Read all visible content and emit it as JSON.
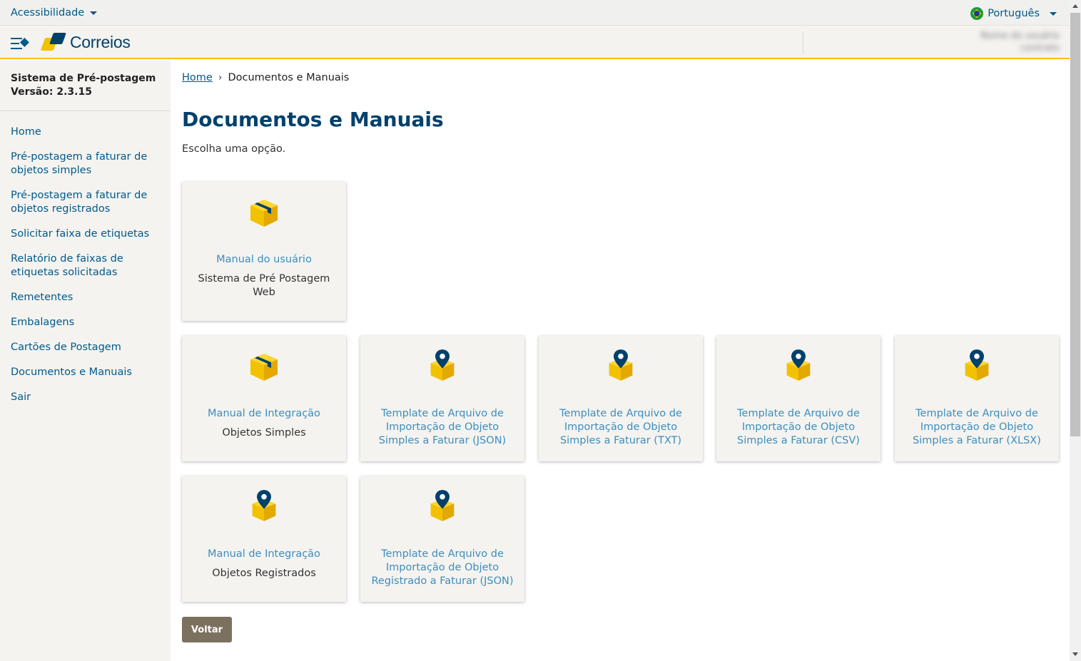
{
  "topbar": {
    "accessibility": "Acessibilidade",
    "language": "Português"
  },
  "header": {
    "logo_text": "Correios",
    "user_name": "Nome do usuário",
    "user_line2": "contrato"
  },
  "sidebar": {
    "system_name": "Sistema de Pré-postagem",
    "version": "Versão: 2.3.15",
    "items": [
      {
        "label": "Home"
      },
      {
        "label": "Pré-postagem a faturar de objetos simples"
      },
      {
        "label": "Pré-postagem a faturar de objetos registrados"
      },
      {
        "label": "Solicitar faixa de etiquetas"
      },
      {
        "label": "Relatório de faixas de etiquetas solicitadas"
      },
      {
        "label": "Remetentes"
      },
      {
        "label": "Embalagens"
      },
      {
        "label": "Cartões de Postagem"
      },
      {
        "label": "Documentos e Manuais"
      },
      {
        "label": "Sair"
      }
    ]
  },
  "breadcrumb": {
    "home": "Home",
    "current": "Documentos e Manuais"
  },
  "page": {
    "title": "Documentos e Manuais",
    "subtitle": "Escolha uma opção."
  },
  "cards": [
    {
      "icon": "box-icon",
      "link": "Manual do usuário",
      "desc": "Sistema de Pré Postagem Web"
    },
    {
      "icon": "box-icon",
      "link": "Manual de Integração",
      "desc": "Objetos Simples"
    },
    {
      "icon": "location-box-icon",
      "link": "Template de Arquivo de Importação de Objeto Simples a Faturar (JSON)",
      "desc": ""
    },
    {
      "icon": "location-box-icon",
      "link": "Template de Arquivo de Importação de Objeto Simples a Faturar (TXT)",
      "desc": ""
    },
    {
      "icon": "location-box-icon",
      "link": "Template de Arquivo de Importação de Objeto Simples a Faturar (CSV)",
      "desc": ""
    },
    {
      "icon": "location-box-icon",
      "link": "Template de Arquivo de Importação de Objeto Simples a Faturar (XLSX)",
      "desc": ""
    },
    {
      "icon": "location-box-icon",
      "link": "Manual de Integração",
      "desc": "Objetos Registrados"
    },
    {
      "icon": "location-box-icon",
      "link": "Template de Arquivo de Importação de Objeto Registrado a Faturar (JSON)",
      "desc": ""
    }
  ],
  "buttons": {
    "back": "Voltar"
  },
  "colors": {
    "brand_blue": "#00416b",
    "link_blue": "#005a8c",
    "card_link": "#3d8ec0",
    "brand_yellow": "#f2c200",
    "button": "#7c705f"
  }
}
